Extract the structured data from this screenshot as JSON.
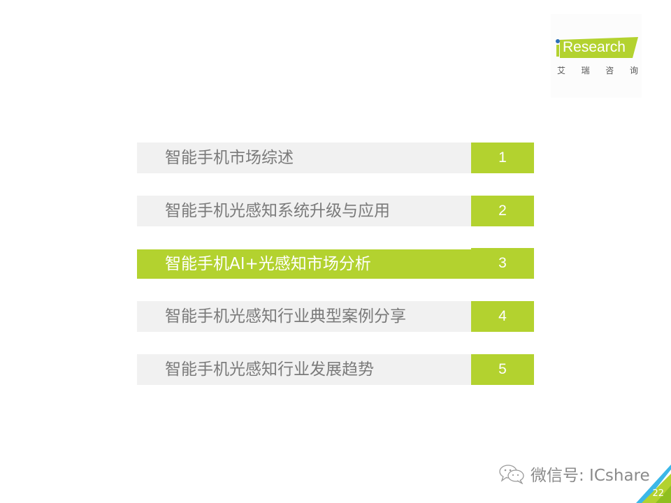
{
  "logo": {
    "brand_i": "i",
    "brand_text": "Research",
    "chinese_chars": [
      "艾",
      "瑞",
      "咨",
      "询"
    ],
    "brand_green": "#b3d22f",
    "dot_blue": "#2d6fb7"
  },
  "toc": {
    "items": [
      {
        "label": "智能手机市场综述",
        "number": "1",
        "active": false
      },
      {
        "label": "智能手机光感知系统升级与应用",
        "number": "2",
        "active": false
      },
      {
        "label": "智能手机AI+光感知市场分析",
        "number": "3",
        "active": true
      },
      {
        "label": "智能手机光感知行业典型案例分享",
        "number": "4",
        "active": false
      },
      {
        "label": "智能手机光感知行业发展趋势",
        "number": "5",
        "active": false
      }
    ],
    "accent_color": "#b3d22f",
    "bar_color": "#f1f1f1"
  },
  "footer": {
    "watermark": "微信号: ICshare",
    "watermark_icon": "wechat-icon",
    "page_number": "22"
  }
}
